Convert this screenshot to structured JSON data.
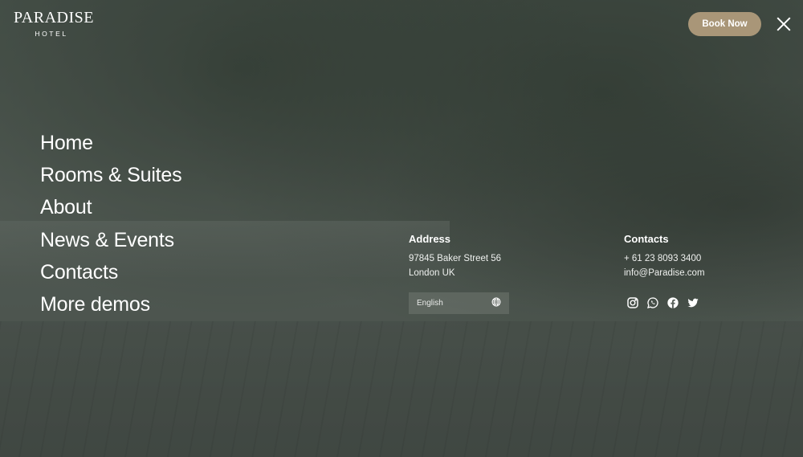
{
  "logo": {
    "brand": "PARADISE",
    "sub": "HOTEL"
  },
  "header": {
    "book_label": "Book Now"
  },
  "menu": {
    "items": [
      {
        "label": "Home"
      },
      {
        "label": "Rooms & Suites"
      },
      {
        "label": "About"
      },
      {
        "label": "News & Events"
      },
      {
        "label": "Contacts"
      },
      {
        "label": "More demos"
      }
    ]
  },
  "address": {
    "title": "Address",
    "line1": "97845 Baker Street 56",
    "line2": "London UK"
  },
  "contacts": {
    "title": "Contacts",
    "phone": "+ 61 23 8093 3400",
    "email": "info@Paradise.com"
  },
  "language": {
    "selected": "English",
    "icon": "globe-icon"
  },
  "socials": [
    "instagram-icon",
    "whatsapp-icon",
    "facebook-icon",
    "twitter-icon"
  ],
  "colors": {
    "accent": "#a99678",
    "overlay": "#5a625c",
    "text": "#ffffff"
  }
}
